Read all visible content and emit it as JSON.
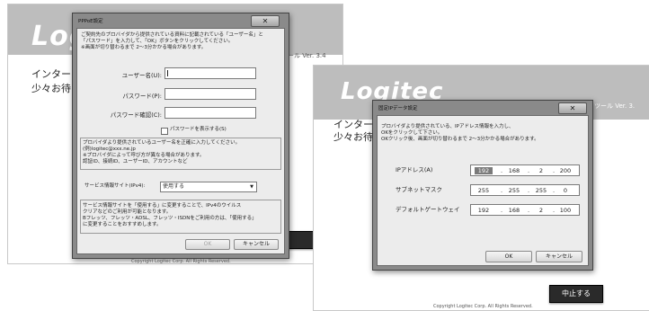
{
  "app_left": {
    "logo": "Log",
    "version": "ツール  Ver. 3.4",
    "body_line1": "インターネ",
    "body_line2": "少々お待ち",
    "copyright": "Copyright Logitec Corp. All Rights Reserved.",
    "partial_button": "る"
  },
  "app_right": {
    "logo": "Logitec",
    "version": "ツール  Ver. 3.",
    "body_line1": "インターネ",
    "body_line2": "少々お待",
    "stop_button": "中止する",
    "copyright": "Copyright Logitec Corp. All Rights Reserved."
  },
  "pppoe_dialog": {
    "title": "PPPoE設定",
    "instructions": [
      "ご契約先のプロバイダから提供されている資料に記載されている「ユーザー名」と",
      "「パスワード」を入力して、「OK」ボタンをクリックしてください。",
      "※画面が切り替わるまで 2〜3分かかる場合があります。"
    ],
    "username_label": "ユーザー名(U):",
    "username_value": "",
    "password_label": "パスワード(P):",
    "password_value": "",
    "password_confirm_label": "パスワード確認(C):",
    "password_confirm_value": "",
    "show_password_label": "パスワードを表示する(S)",
    "note_lines": [
      "プロバイダより提供されているユーザー名を正確に入力してください。",
      "(例)logitec@xxx.ne.jp",
      "※プロバイダによって呼び方が異なる場合があります。",
      "  認証ID、接続ID、ユーザーID、アカウントなど"
    ],
    "service_label": "サービス情報サイト(IPv4):",
    "service_value": "使用する",
    "service_note_lines": [
      "サービス情報サイトを「使用する」に変更することで、IPv4のウイルス",
      "クリアなどのご利用が可能となります。",
      "Bフレッツ、フレッツ・ADSL、フレッツ・ISDNをご利用の方は、「使用する」",
      "に変更することをおすすめします。"
    ],
    "ok_label": "OK",
    "cancel_label": "キャンセル"
  },
  "fixed_ip_dialog": {
    "title": "固定IPデータ設定",
    "instructions": [
      "プロバイダより提供されている、IPアドレス情報を入力し、",
      "OKをクリックして下さい。",
      "OKクリック後、画面が切り替わるまで 2〜3分かかる場合があります。"
    ],
    "ip_label": "IPアドレス(A)",
    "ip": [
      "192",
      "168",
      "2",
      "200"
    ],
    "subnet_label": "サブネットマスク",
    "subnet": [
      "255",
      "255",
      "255",
      "0"
    ],
    "gateway_label": "デフォルトゲートウェイ",
    "gateway": [
      "192",
      "168",
      "2",
      "100"
    ],
    "ok_label": "OK",
    "cancel_label": "キャンセル"
  },
  "icons": {
    "close": "close-icon",
    "dropdown": "chevron-down-icon"
  }
}
